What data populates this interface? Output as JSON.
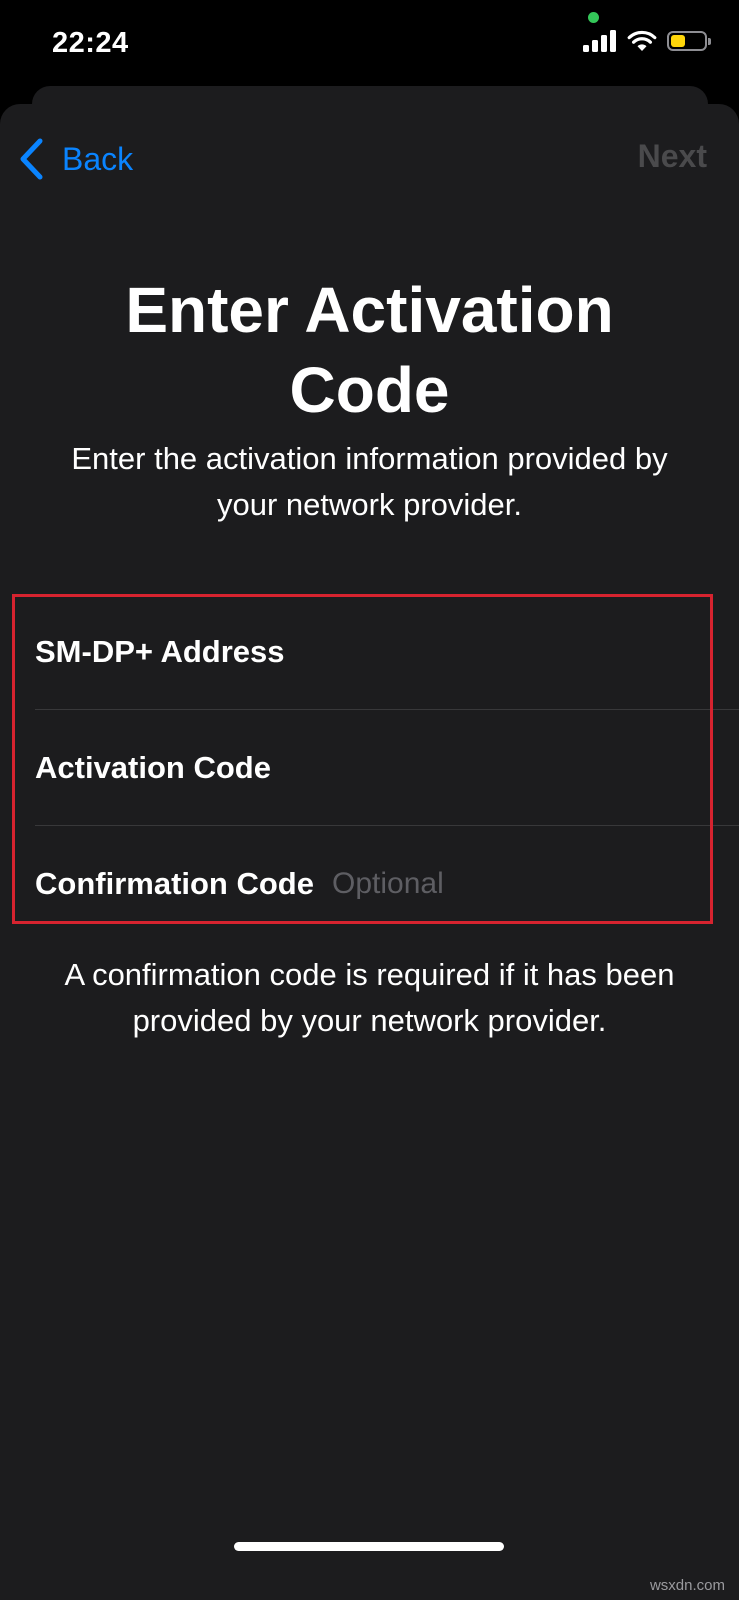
{
  "status_bar": {
    "time": "22:24",
    "battery_level": 0.45,
    "colors": {
      "battery": "#ffd60a",
      "privacy_dot": "#34c759"
    }
  },
  "nav": {
    "back_label": "Back",
    "back_icon": "chevron-left-icon",
    "next_label": "Next"
  },
  "content": {
    "title": "Enter Activation Code",
    "subtitle": "Enter the activation information provided by your network provider.",
    "fields": [
      {
        "label": "SM-DP+ Address",
        "placeholder": ""
      },
      {
        "label": "Activation Code",
        "placeholder": ""
      },
      {
        "label": "Confirmation Code",
        "placeholder": "Optional"
      }
    ],
    "footnote": "A confirmation code is required if it has been provided by your network provider."
  },
  "watermark": "wsxdn.com",
  "colors": {
    "accent": "#0a84ff",
    "highlight": "#d6232f",
    "sheet_background": "#1c1c1e"
  }
}
